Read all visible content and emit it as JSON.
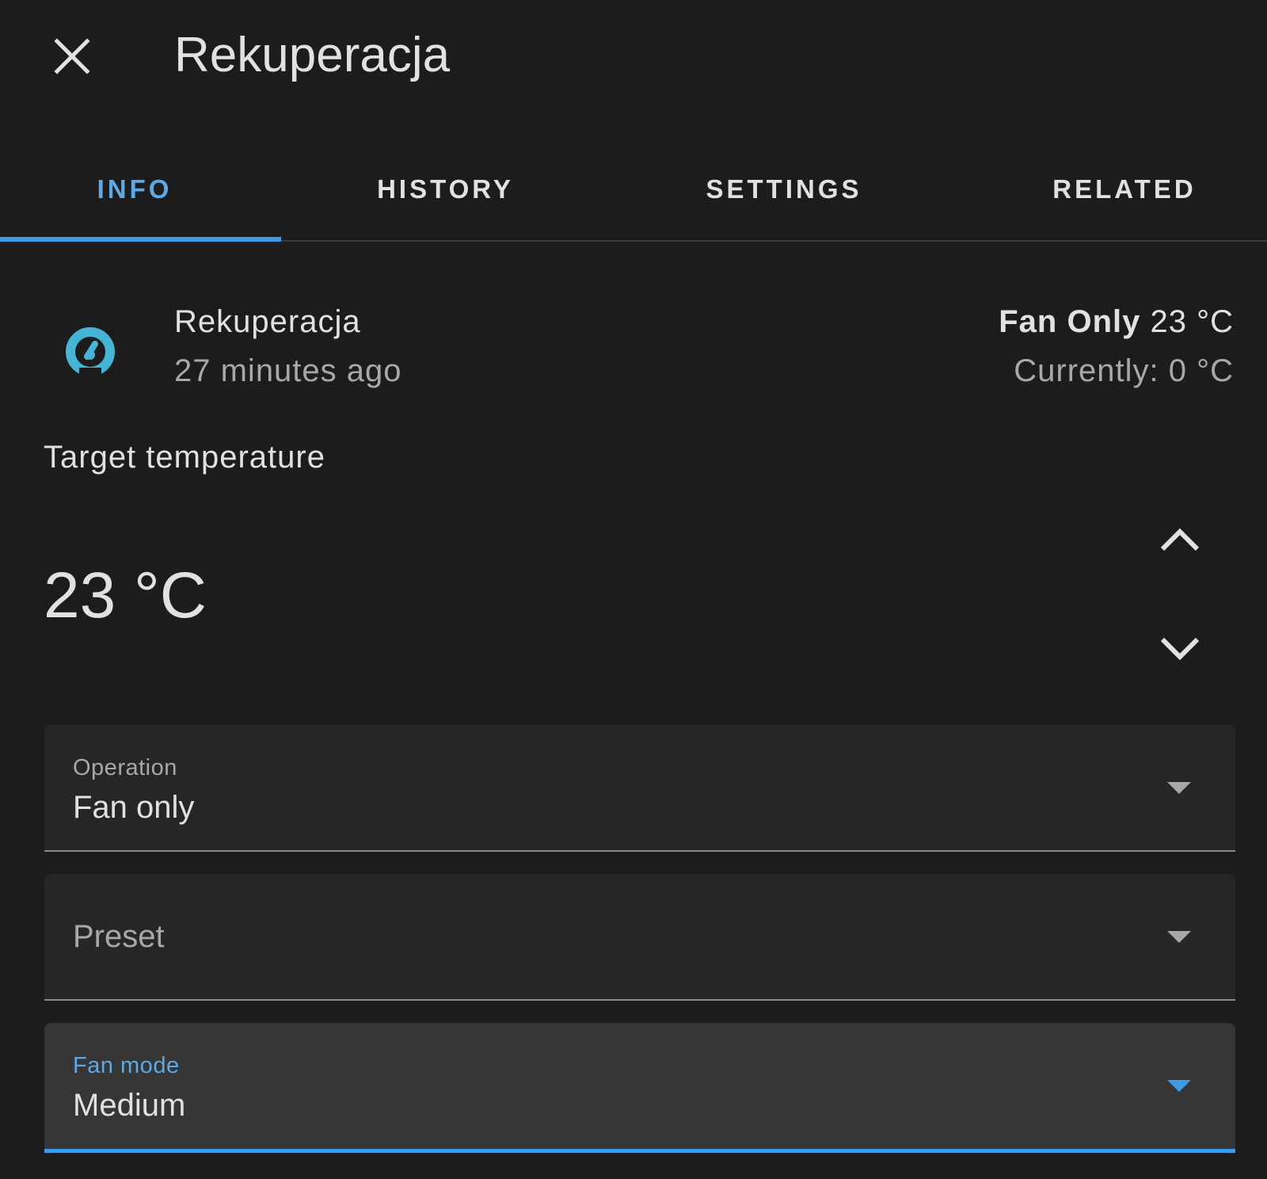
{
  "dialog": {
    "title": "Rekuperacja"
  },
  "tabs": [
    {
      "label": "INFO",
      "active": true
    },
    {
      "label": "HISTORY",
      "active": false
    },
    {
      "label": "SETTINGS",
      "active": false
    },
    {
      "label": "RELATED",
      "active": false
    }
  ],
  "entity": {
    "name": "Rekuperacja",
    "last_changed": "27 minutes ago",
    "state_mode": "Fan Only",
    "state_target": "23 °C",
    "current": "Currently: 0 °C",
    "icon": "thermostat-dial-icon"
  },
  "target": {
    "label": "Target temperature",
    "value": "23 °C"
  },
  "fields": {
    "operation": {
      "label": "Operation",
      "value": "Fan only"
    },
    "preset": {
      "label": "Preset",
      "value": ""
    },
    "fan_mode": {
      "label": "Fan mode",
      "value": "Medium"
    }
  },
  "colors": {
    "background": "#1c1c1c",
    "accent": "#3c9be6",
    "icon": "#44b4d7",
    "field_bg": "#262626",
    "field_focused_bg": "#363636"
  }
}
